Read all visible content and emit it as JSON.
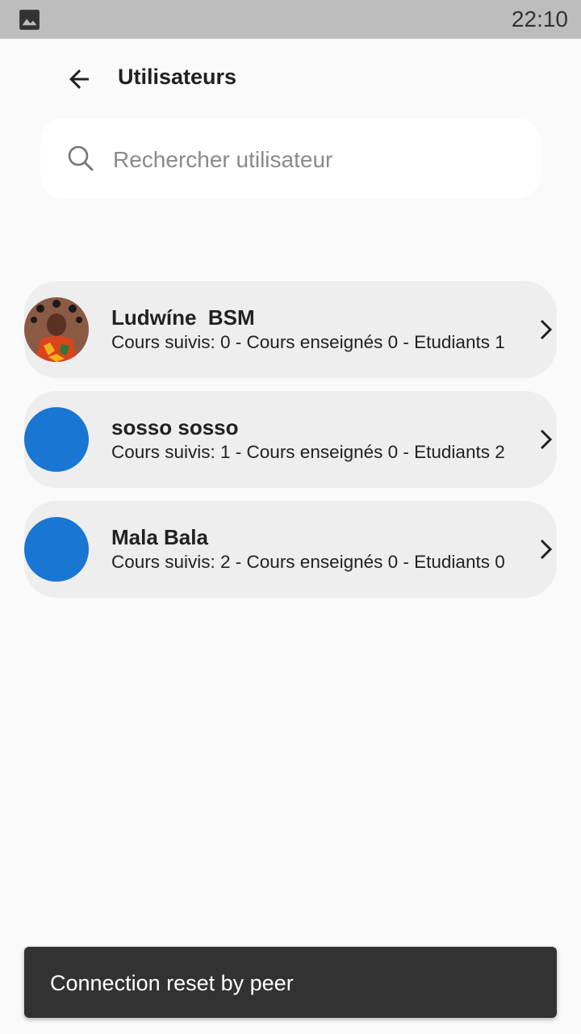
{
  "status_bar": {
    "time": "22:10",
    "left_icon": "image-icon"
  },
  "app_bar": {
    "back_icon": "arrow-left-icon",
    "title": "Utilisateurs"
  },
  "search": {
    "placeholder": "Rechercher utilisateur",
    "value": "",
    "icon": "search-icon"
  },
  "users": [
    {
      "name": "Ludwíne  BSM",
      "stats": "Cours suivis: 0 - Cours enseignés 0 - Etudiants 1",
      "avatar": "photo"
    },
    {
      "name": "sosso sosso",
      "stats": "Cours suivis: 1 - Cours enseignés 0 - Etudiants 2",
      "avatar": "blue-circle"
    },
    {
      "name": "Mala Bala",
      "stats": "Cours suivis: 2 - Cours enseignés 0 - Etudiants 0",
      "avatar": "blue-circle"
    }
  ],
  "snackbar": {
    "message": "Connection reset by peer"
  },
  "colors": {
    "avatar_blue": "#1976d2",
    "card_bg": "#eeeeee",
    "page_bg": "#fafafa",
    "snackbar_bg": "#323232"
  }
}
